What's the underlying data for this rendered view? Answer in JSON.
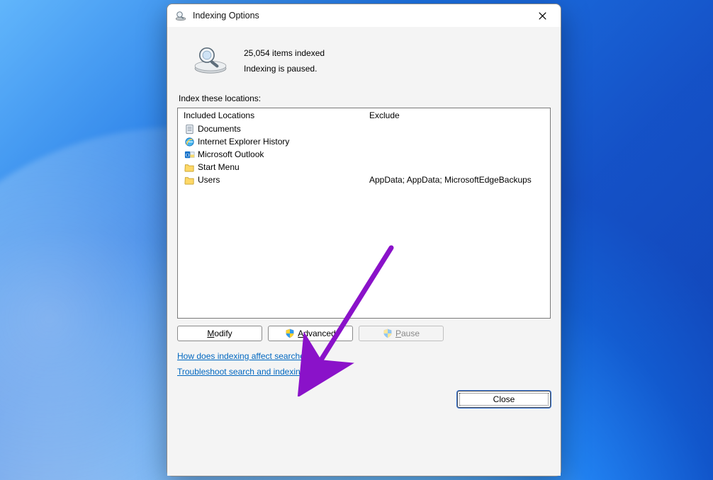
{
  "titlebar": {
    "title": "Indexing Options"
  },
  "summary": {
    "count_line": "25,054 items indexed",
    "status_line": "Indexing is paused."
  },
  "locations_label": "Index these locations:",
  "columns": {
    "included": "Included Locations",
    "exclude": "Exclude"
  },
  "rows": [
    {
      "icon": "doc",
      "name": "Documents",
      "exclude": ""
    },
    {
      "icon": "ie",
      "name": "Internet Explorer History",
      "exclude": ""
    },
    {
      "icon": "outlook",
      "name": "Microsoft Outlook",
      "exclude": ""
    },
    {
      "icon": "folder",
      "name": "Start Menu",
      "exclude": ""
    },
    {
      "icon": "folder",
      "name": "Users",
      "exclude": "AppData; AppData; MicrosoftEdgeBackups"
    }
  ],
  "buttons": {
    "modify": "Modify",
    "advanced": "Advanced",
    "pause": "Pause",
    "close": "Close"
  },
  "links": {
    "help": "How does indexing affect searches?",
    "troubleshoot": "Troubleshoot search and indexing"
  },
  "accent_arrow_color": "#8a12c9"
}
